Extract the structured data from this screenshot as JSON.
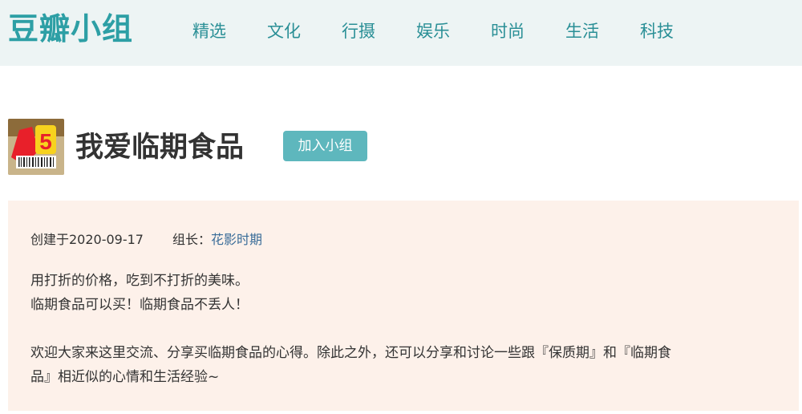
{
  "header": {
    "logo": "豆瓣小组",
    "nav": [
      "精选",
      "文化",
      "行摄",
      "娱乐",
      "时尚",
      "生活",
      "科技"
    ]
  },
  "group": {
    "title": "我爱临期食品",
    "join_label": "加入小组",
    "avatar_badge": "5"
  },
  "info": {
    "created": "创建于2020-09-17",
    "owner_label": "组长：",
    "owner_name": "花影时期",
    "line1": "用打折的价格，吃到不打折的美味。",
    "line2": "临期食品可以买！临期食品不丢人！",
    "line3": "欢迎大家来这里交流、分享买临期食品的心得。除此之外，还可以分享和讨论一些跟『保质期』和『临期食",
    "line4": "品』相近似的心情和生活经验~"
  },
  "colors": {
    "brand": "#2d9fa5",
    "button": "#5eb7bd",
    "panel": "#fdf1ea"
  }
}
